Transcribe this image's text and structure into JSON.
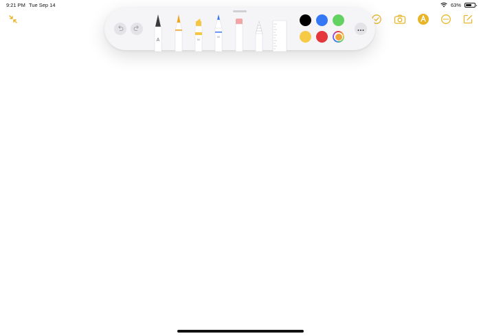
{
  "status_bar": {
    "time": "9:21 PM",
    "date": "Tue Sep 14",
    "battery_percent": "63%",
    "battery_level": 0.63,
    "wifi_icon": "wifi-icon",
    "battery_icon": "battery-icon"
  },
  "toolbar": {
    "accent_color": "#e8b528",
    "icons": [
      "collapse-arrows-icon",
      "checklist-icon",
      "camera-icon",
      "markup-pen-icon",
      "more-ellipsis-icon",
      "compose-icon"
    ]
  },
  "tool_palette": {
    "undo_icon": "undo-icon",
    "redo_icon": "redo-icon",
    "more_icon": "more-ellipsis-icon",
    "tools": [
      {
        "name": "pen",
        "tip_label": "A"
      },
      {
        "name": "monoline",
        "tip_color": "#f0a41b"
      },
      {
        "name": "highlighter",
        "tip_color": "#f6c542",
        "size_label": "50"
      },
      {
        "name": "pencil",
        "tip_color": "#3478f6",
        "size_label": "50"
      },
      {
        "name": "eraser",
        "tip_color": "#f2a5a5"
      },
      {
        "name": "lasso"
      },
      {
        "name": "ruler"
      }
    ],
    "colors": [
      {
        "name": "black",
        "hex": "#000000"
      },
      {
        "name": "blue",
        "hex": "#3478f6"
      },
      {
        "name": "green",
        "hex": "#64d163"
      },
      {
        "name": "yellow",
        "hex": "#f7ca46"
      },
      {
        "name": "red",
        "hex": "#e4363b"
      },
      {
        "name": "custom",
        "hex": "#f2a23a",
        "selected": true
      }
    ]
  }
}
